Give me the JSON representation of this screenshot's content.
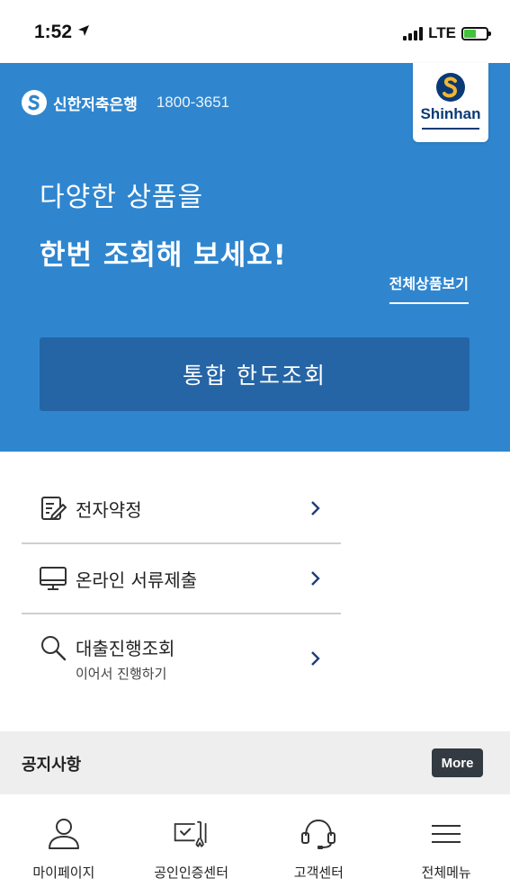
{
  "status_bar": {
    "time": "1:52",
    "network": "LTE",
    "icons": [
      "location-arrow-icon",
      "signal-icon",
      "battery-charging-icon"
    ]
  },
  "hero": {
    "brand_name": "신한저축은행",
    "phone": "1800-3651",
    "logo_text": "Shinhan",
    "headline_line1": "다양한 상품을",
    "headline_line2": "한번 조회해 보세요!",
    "all_products_link": "전체상품보기",
    "limit_button": "통합 한도조회",
    "colors": {
      "background": "#2f86cf",
      "button": "#2565a6",
      "logo_navy": "#0a3a76"
    }
  },
  "menu": {
    "items": [
      {
        "label": "전자약정",
        "sub": "",
        "icon": "e-contract-icon"
      },
      {
        "label": "온라인 서류제출",
        "sub": "",
        "icon": "monitor-icon"
      },
      {
        "label": "대출진행조회",
        "sub": "이어서 진행하기",
        "icon": "search-icon"
      }
    ]
  },
  "notice": {
    "title": "공지사항",
    "more_button": "More"
  },
  "tabbar": {
    "items": [
      {
        "label": "마이페이지",
        "icon": "person-icon"
      },
      {
        "label": "공인인증센터",
        "icon": "certificate-icon"
      },
      {
        "label": "고객센터",
        "icon": "headset-icon"
      },
      {
        "label": "전체메뉴",
        "icon": "hamburger-menu-icon"
      }
    ]
  }
}
